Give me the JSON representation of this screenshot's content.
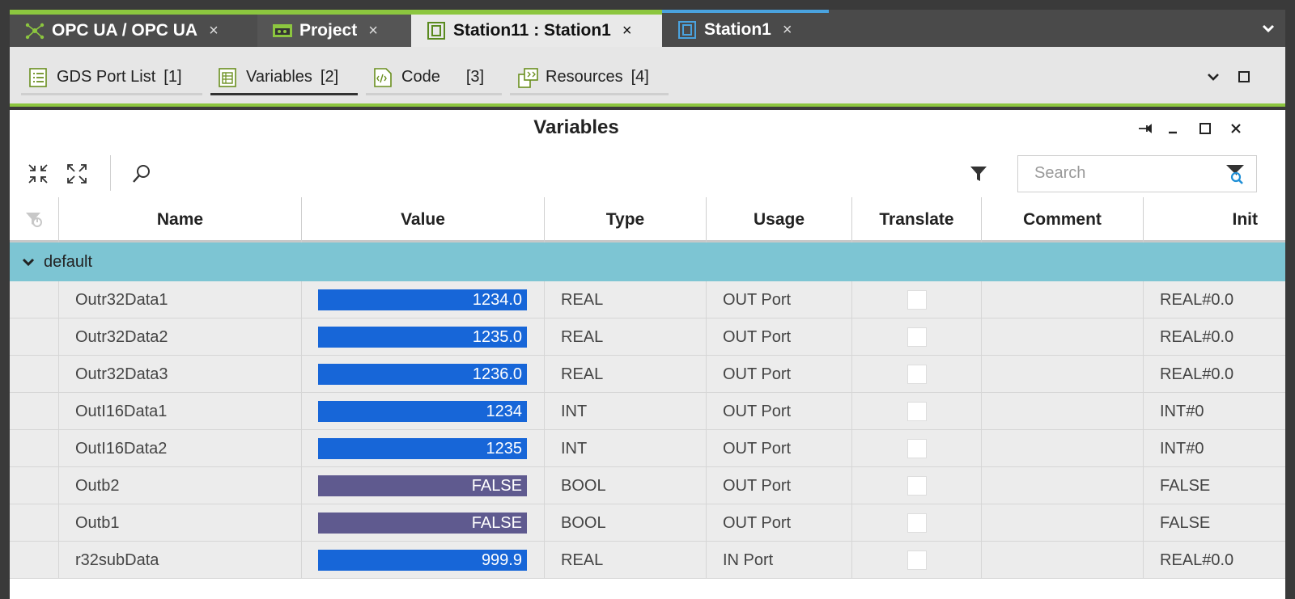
{
  "tabs": [
    {
      "label": "OPC UA / OPC UA",
      "close": "×",
      "icon": "network-node-icon"
    },
    {
      "label": "Project",
      "close": "×",
      "icon": "project-icon"
    },
    {
      "label": "Station11 : Station1",
      "close": "×",
      "icon": "station-icon"
    },
    {
      "label": "Station1",
      "close": "×",
      "icon": "station-icon"
    }
  ],
  "subtabs": [
    {
      "label": "GDS Port List",
      "num": "[1]",
      "icon": "list-icon"
    },
    {
      "label": "Variables",
      "num": "[2]",
      "icon": "variables-icon"
    },
    {
      "label": "Code",
      "num": "[3]",
      "icon": "code-icon"
    },
    {
      "label": "Resources",
      "num": "[4]",
      "icon": "resources-icon"
    }
  ],
  "panel": {
    "title": "Variables",
    "search_placeholder": "Search"
  },
  "columns": [
    "Name",
    "Value",
    "Type",
    "Usage",
    "Translate",
    "Comment",
    "Init"
  ],
  "group": {
    "label": "default"
  },
  "rows": [
    {
      "name": "Outr32Data1",
      "value": "1234.0",
      "kind": "num",
      "type": "REAL",
      "usage": "OUT Port",
      "translate": false,
      "comment": "",
      "init": "REAL#0.0"
    },
    {
      "name": "Outr32Data2",
      "value": "1235.0",
      "kind": "num",
      "type": "REAL",
      "usage": "OUT Port",
      "translate": false,
      "comment": "",
      "init": "REAL#0.0"
    },
    {
      "name": "Outr32Data3",
      "value": "1236.0",
      "kind": "num",
      "type": "REAL",
      "usage": "OUT Port",
      "translate": false,
      "comment": "",
      "init": "REAL#0.0"
    },
    {
      "name": "OutI16Data1",
      "value": "1234",
      "kind": "num",
      "type": "INT",
      "usage": "OUT Port",
      "translate": false,
      "comment": "",
      "init": "INT#0"
    },
    {
      "name": "OutI16Data2",
      "value": "1235",
      "kind": "num",
      "type": "INT",
      "usage": "OUT Port",
      "translate": false,
      "comment": "",
      "init": "INT#0"
    },
    {
      "name": "Outb2",
      "value": "FALSE",
      "kind": "bool",
      "type": "BOOL",
      "usage": "OUT Port",
      "translate": false,
      "comment": "",
      "init": "FALSE"
    },
    {
      "name": "Outb1",
      "value": "FALSE",
      "kind": "bool",
      "type": "BOOL",
      "usage": "OUT Port",
      "translate": false,
      "comment": "",
      "init": "FALSE"
    },
    {
      "name": "r32subData",
      "value": "999.9",
      "kind": "num",
      "type": "REAL",
      "usage": "IN Port",
      "translate": false,
      "comment": "",
      "init": "REAL#0.0"
    }
  ],
  "colors": {
    "accent": "#8cc63f",
    "group_bg": "#7dc5d3",
    "value_num": "#1766d8",
    "value_bool": "#5f5a8f",
    "tab_blue": "#4aa3df"
  }
}
